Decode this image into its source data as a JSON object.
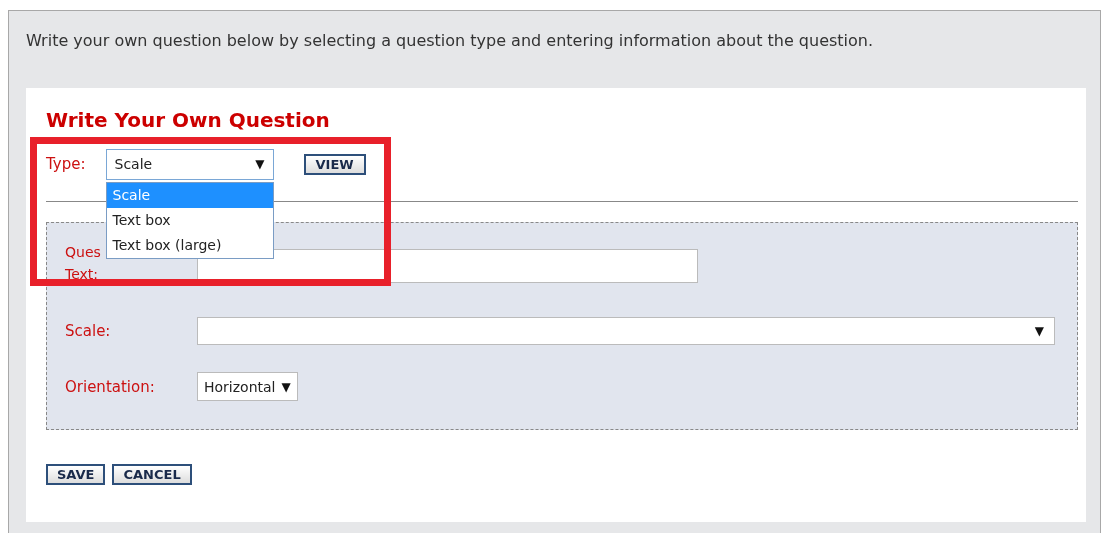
{
  "intro": "Write your own question below by selecting a question type and entering information about the question.",
  "title": "Write Your Own Question",
  "type_field": {
    "label": "Type:",
    "value": "Scale",
    "expanded": true,
    "options": [
      {
        "label": "Scale",
        "selected": true
      },
      {
        "label": "Text box",
        "selected": false
      },
      {
        "label": "Text box (large)",
        "selected": false
      }
    ]
  },
  "view_button": "VIEW",
  "question_text": {
    "label_lines": [
      "Ques",
      "Text:"
    ]
  },
  "scale_field": {
    "label": "Scale:",
    "caret": "▼"
  },
  "orientation_field": {
    "label": "Orientation:",
    "value": "Horizontal",
    "caret": "▼"
  },
  "type_caret": "▼",
  "buttons": [
    "SAVE",
    "CANCEL"
  ],
  "highlight": true
}
